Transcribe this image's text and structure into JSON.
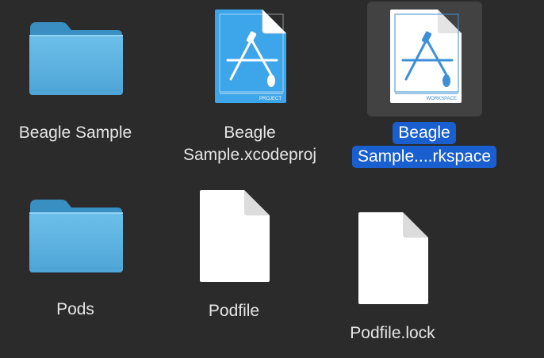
{
  "window": {
    "background": "#2b2b2b",
    "selection_color": "#1a5fcf"
  },
  "files": [
    {
      "name_line1": "Beagle Sample",
      "name_line2": "",
      "icon": "folder-icon",
      "selected": false
    },
    {
      "name_line1": "Beagle",
      "name_line2": "Sample.xcodeproj",
      "icon": "xcode-project-icon",
      "badge": "PROJECT",
      "selected": false
    },
    {
      "name_line1": "Beagle",
      "name_line2": "Sample....rkspace",
      "icon": "xcode-workspace-icon",
      "badge": "WORKSPACE",
      "selected": true
    },
    {
      "name_line1": "Pods",
      "name_line2": "",
      "icon": "folder-icon",
      "selected": false
    },
    {
      "name_line1": "Podfile",
      "name_line2": "",
      "icon": "document-icon",
      "selected": false
    },
    {
      "name_line1": "Podfile.lock",
      "name_line2": "",
      "icon": "document-icon",
      "selected": false
    }
  ]
}
